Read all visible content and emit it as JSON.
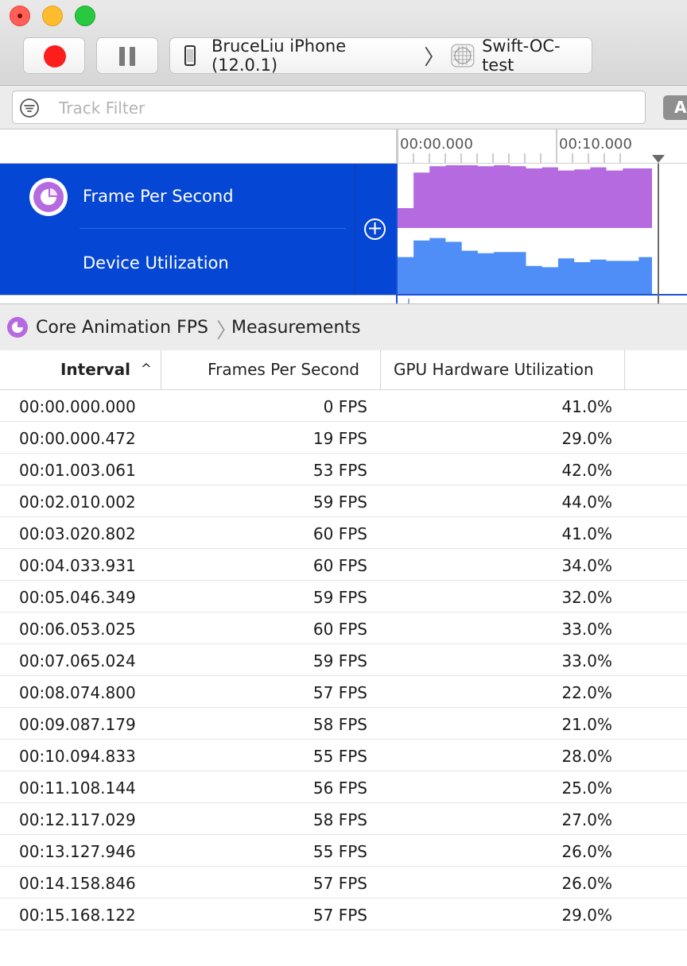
{
  "toolbar": {
    "device": "BruceLiu iPhone (12.0.1)",
    "separator": "〉",
    "app": "Swift-OC-test"
  },
  "filter": {
    "placeholder": "Track Filter",
    "all_label": "A"
  },
  "timeline": {
    "ticks": [
      "00:00.000",
      "00:10.000"
    ],
    "tracks": [
      {
        "label": "Frame Per Second",
        "color": "#b56ae0"
      },
      {
        "label": "Device Utilization",
        "color": "#4f8ef7"
      }
    ]
  },
  "inspector": {
    "breadcrumb": [
      "Core Animation FPS",
      "Measurements"
    ],
    "breadcrumb_separator": "〉"
  },
  "table": {
    "columns": [
      "Interval",
      "Frames Per Second",
      "GPU Hardware Utilization"
    ],
    "sort_indicator": "^",
    "rows": [
      [
        "00:00.000.000",
        "0 FPS",
        "41.0%"
      ],
      [
        "00:00.000.472",
        "19 FPS",
        "29.0%"
      ],
      [
        "00:01.003.061",
        "53 FPS",
        "42.0%"
      ],
      [
        "00:02.010.002",
        "59 FPS",
        "44.0%"
      ],
      [
        "00:03.020.802",
        "60 FPS",
        "41.0%"
      ],
      [
        "00:04.033.931",
        "60 FPS",
        "34.0%"
      ],
      [
        "00:05.046.349",
        "59 FPS",
        "32.0%"
      ],
      [
        "00:06.053.025",
        "60 FPS",
        "33.0%"
      ],
      [
        "00:07.065.024",
        "59 FPS",
        "33.0%"
      ],
      [
        "00:08.074.800",
        "57 FPS",
        "22.0%"
      ],
      [
        "00:09.087.179",
        "58 FPS",
        "21.0%"
      ],
      [
        "00:10.094.833",
        "55 FPS",
        "28.0%"
      ],
      [
        "00:11.108.144",
        "56 FPS",
        "25.0%"
      ],
      [
        "00:12.117.029",
        "58 FPS",
        "27.0%"
      ],
      [
        "00:13.127.946",
        "55 FPS",
        "26.0%"
      ],
      [
        "00:14.158.846",
        "57 FPS",
        "26.0%"
      ],
      [
        "00:15.168.122",
        "57 FPS",
        "29.0%"
      ]
    ]
  },
  "colors": {
    "record": "#fc1d1d",
    "track_selection": "#0547d4",
    "fps_graph": "#b56ae0",
    "gpu_graph": "#4f8ef7"
  }
}
